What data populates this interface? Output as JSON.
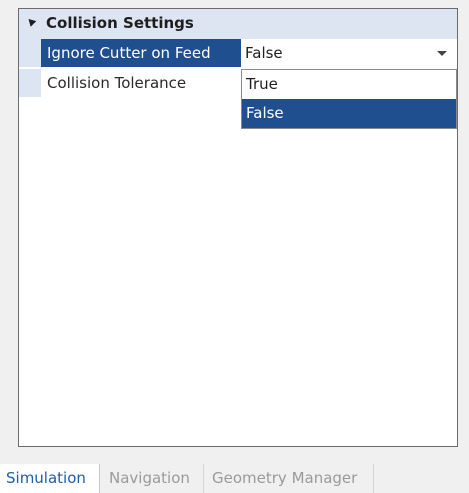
{
  "property_grid": {
    "category": {
      "label": "Collision Settings"
    },
    "rows": [
      {
        "name": "Ignore Cutter on Feed",
        "value": "False"
      },
      {
        "name": "Collision Tolerance",
        "value": ""
      }
    ],
    "dropdown": {
      "options": [
        "True",
        "False"
      ],
      "selected": "False"
    }
  },
  "tabs": [
    {
      "label": "Simulation",
      "active": true
    },
    {
      "label": "Navigation",
      "active": false
    },
    {
      "label": "Geometry Manager",
      "active": false
    }
  ],
  "colors": {
    "selection": "#1f4f8f",
    "category_band": "#dde4f2",
    "active_tab_text": "#1a5fa8",
    "inactive_tab_text": "#9a9a9a"
  },
  "icons": {
    "expander": "triangle-collapse-icon",
    "dropdown": "chevron-down-icon"
  }
}
